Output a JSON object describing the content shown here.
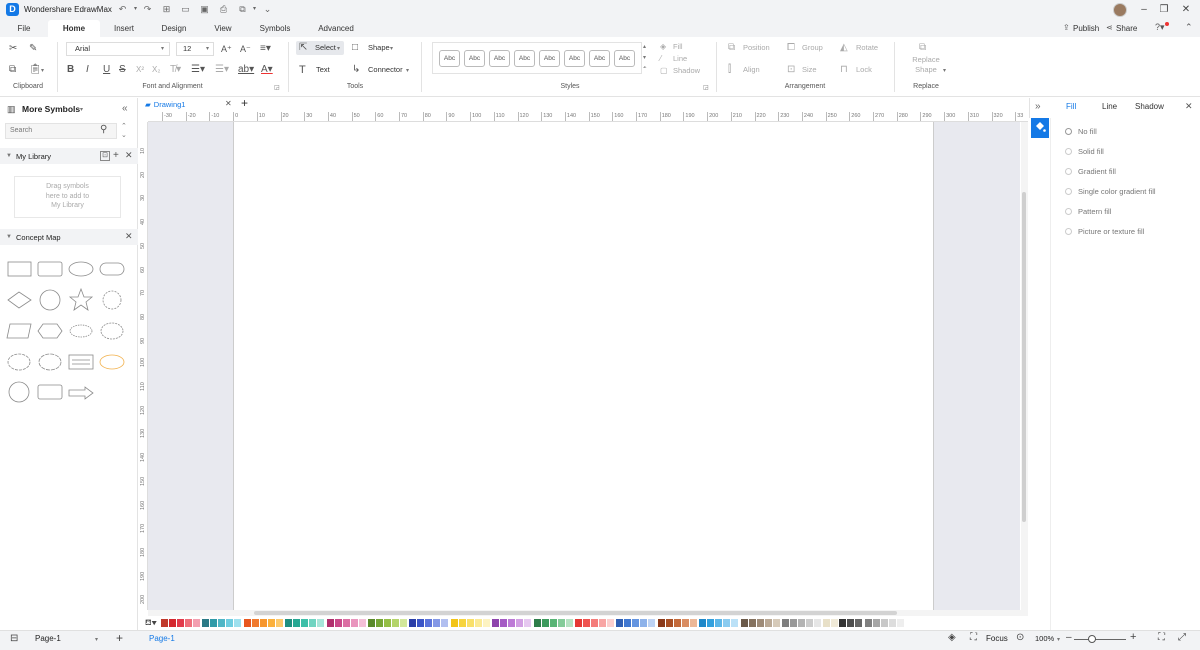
{
  "app": {
    "title": "Wondershare EdrawMax",
    "logo_letter": "D"
  },
  "menu": {
    "tabs": [
      "File",
      "Home",
      "Insert",
      "Design",
      "View",
      "Symbols",
      "Advanced"
    ],
    "active_tab": "Home",
    "publish": "Publish",
    "share": "Share"
  },
  "ribbon": {
    "font_name": "Arial",
    "font_size": "12",
    "groups": {
      "clipboard": "Clipboard",
      "font": "Font and Alignment",
      "tools": "Tools",
      "styles": "Styles",
      "arrangement": "Arrangement",
      "replace": "Replace"
    },
    "tools": {
      "select": "Select",
      "shape": "Shape",
      "text": "Text",
      "connector": "Connector"
    },
    "style_preview": "Abc",
    "style_props": {
      "fill": "Fill",
      "line": "Line",
      "shadow": "Shadow"
    },
    "arrangement": {
      "position": "Position",
      "group": "Group",
      "rotate": "Rotate",
      "align": "Align",
      "size": "Size",
      "lock": "Lock"
    },
    "replace_shape": {
      "line1": "Replace",
      "line2": "Shape"
    }
  },
  "left_panel": {
    "title": "More Symbols",
    "search_placeholder": "Search",
    "my_library": "My Library",
    "drop_hint": {
      "line1": "Drag symbols",
      "line2": "here to add to",
      "line3": "My Library"
    },
    "concept_map": "Concept Map"
  },
  "document": {
    "tab": "Drawing1"
  },
  "rulers": {
    "h_ticks": [
      "-30",
      "-20",
      "-10",
      "0",
      "10",
      "20",
      "30",
      "40",
      "50",
      "60",
      "70",
      "80",
      "90",
      "100",
      "110",
      "120",
      "130",
      "140",
      "150",
      "160",
      "170",
      "180",
      "190",
      "200",
      "210",
      "220",
      "230",
      "240",
      "250",
      "260",
      "270",
      "280",
      "290",
      "300",
      "310",
      "320",
      "33"
    ],
    "v_ticks": [
      "10",
      "20",
      "30",
      "40",
      "50",
      "60",
      "70",
      "80",
      "90",
      "100",
      "110",
      "120",
      "130",
      "140",
      "150",
      "160",
      "170",
      "180",
      "190",
      "200"
    ]
  },
  "right_panel": {
    "tabs": [
      "Fill",
      "Line",
      "Shadow"
    ],
    "active_tab": "Fill",
    "fill_options": [
      "No fill",
      "Solid fill",
      "Gradient fill",
      "Single color gradient fill",
      "Pattern fill",
      "Picture or texture fill"
    ]
  },
  "palette": [
    "#c0392b",
    "#d4272e",
    "#e23a4b",
    "#ef6f7b",
    "#f39fb0",
    "#2b7a86",
    "#2f9aa8",
    "#4fb6c6",
    "#6fcde0",
    "#9ee0ee",
    "#e8571f",
    "#f07a2e",
    "#f7962c",
    "#fbb03b",
    "#fcc96b",
    "#1f8f7f",
    "#27a893",
    "#3dbfa8",
    "#6fd4c1",
    "#a7e5d9",
    "#b0306d",
    "#c94989",
    "#db6fa3",
    "#e995bd",
    "#f3c0d7",
    "#5a8a2a",
    "#76a636",
    "#95bf45",
    "#b4d46a",
    "#d2e79b",
    "#2a3ea8",
    "#3b55c7",
    "#5c74db",
    "#8498e6",
    "#b1bff0",
    "#f2c417",
    "#f7d43d",
    "#f9e06a",
    "#fbea95",
    "#fdf3c2",
    "#8e44ad",
    "#a55bc4",
    "#bd7ad6",
    "#d29fe3",
    "#e6c8f0",
    "#2e7d4a",
    "#3c9a5c",
    "#58b575",
    "#84cc99",
    "#b6e2c2",
    "#e53935",
    "#ef5350",
    "#f47c7a",
    "#f8a5a4",
    "#fbcfce",
    "#2f5fb3",
    "#4078d1",
    "#6394e0",
    "#8db2ea",
    "#bdd3f4",
    "#8b3a1a",
    "#a84f24",
    "#c46a3a",
    "#d98d62",
    "#ecb898",
    "#1e88c9",
    "#32a0de",
    "#5cb6e8",
    "#8acbf0",
    "#bbe1f7",
    "#6b5a4a",
    "#85725f",
    "#9e8b78",
    "#baa996",
    "#d6cab9",
    "#7f7f7f",
    "#999999",
    "#b3b3b3",
    "#cccccc",
    "#e6e6e6",
    "#e8e0c8",
    "#f0ead8",
    "#333333",
    "#4d4d4d",
    "#666666",
    "#808080",
    "#a6a6a6",
    "#c8c8c8",
    "#dddddd",
    "#eeeeee"
  ],
  "status": {
    "page": "Page-1",
    "page_tab": "Page-1",
    "focus": "Focus",
    "zoom": "100%"
  },
  "accent": "#1479e6"
}
